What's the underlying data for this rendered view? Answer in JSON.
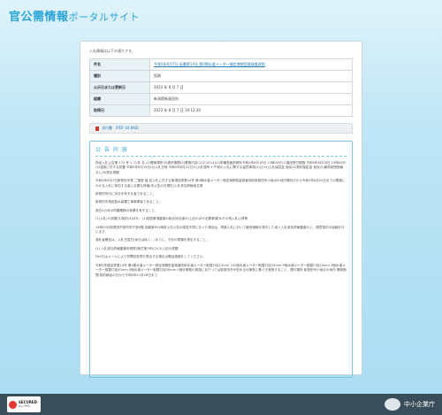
{
  "header": {
    "title": "官公需情報",
    "subtitle": "ポータルサイト"
  },
  "intro": "入札情報は以下の通りです。",
  "info_rows": [
    {
      "label": "件名",
      "value": "令和5年8月7日 延書第14号 第4期水道メーター検定満期型量検査改削",
      "link": true
    },
    {
      "label": "種別",
      "value": "役務",
      "link": false
    },
    {
      "label": "公示日または更新日",
      "value": "2023 年 8 月 7 日",
      "link": false
    },
    {
      "label": "組織",
      "value": "新潟県新発田市",
      "link": false
    },
    {
      "label": "取得日",
      "value": "2023 年 8 月 7 日 19:12:30",
      "link": false
    }
  ],
  "attachment": {
    "label": "添付書 （PDF 44.6KB）"
  },
  "content": {
    "title": "公 告 内 容",
    "paragraphs": [
      "物品入札公告第 173 号 1 (1)件 名 (2)履取場所(3)委託期間(4)業務内容(1)(2)(3)(4)(1)準備書面前期年令和5年8月18日 15時00分(1)運用受付期限 令和5年8月18日 15時00分(3)運用に付する設置 令和5年8月16日(4)入札日時 令和5年8月22日(5)入札場所 4 午前の入札に関する留意事項(1)(2)(3)入札保証金 免除(4)契約保証金 免除(5)最低制限価格 なし(6)提出書類",
      "令和5年8月7日新発田市長 二階堂 馨 記入札に付する事項延書第14号 第4期水道メーター検定満期型量検査改削新発田市小坂ほか地内等約日から令和5年8月20日までの業務にかかる入札に参加する者に必要な資格(本公告の日現在)入札参加資格者名簿",
      "新発田市内に本社を有する者であること。",
      "新発田市指定給水装置工事事業者であること。",
      "過去5カ年の同種業務の実績を有すること。",
      "(1)入札(2)設置(3)契約(4)ほか、(1)経営事項審査の総合評点値(5)上記のほか必要事項(6)その他入札心得等",
      "14時20分新発田市役所本庁舎6階 会議室601两前入札公告の縦覧不算になった場合は、再度入札において最低価格を提示した者と入札参加資格審査の上、随意契約の協議を行います。",
      "落札者確定は、入札日翌日(休日は除く。)までに、下記の書類を提出すること。",
      "(1) 入札参加資格審査申請書(様式第1号)(2)(3)上記の書類",
      "FAX又はメールにより質問回答書を提出する場合は電話連絡をしてください。",
      "令和5年度延書第14号 第4期水道メーター検定満期型量検査改削水道メーター取替口径13mm 242個水道メーター取替口径20mm 9個水道メーター取替口径25mm 3個水道メーター取替口径40mm 0個水道メーター取替口径50mm 0個本業務の実施にあたっては新発田市が定める仕様書に基づき実施すること。履行場所 新発田市小坂ほか地内 業務期間 契約締結の日から令和5年12月28日まで"
    ]
  },
  "footer": {
    "secured_title": "SECURED",
    "secured_sub": "by JPRS",
    "agency_name": "中小企業庁"
  },
  "colors": {
    "accent": "#2aa3d6",
    "footer_bg": "#3a4d5a",
    "link": "#2479b8"
  }
}
